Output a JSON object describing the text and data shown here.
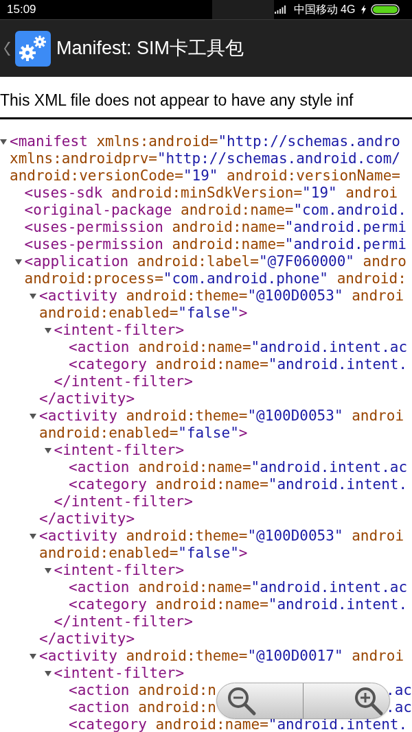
{
  "status_bar": {
    "time": "15:09",
    "carrier": "中国移动 4G"
  },
  "header": {
    "title": "Manifest: SIM卡工具包"
  },
  "notice": "This XML file does not appear to have any style inf",
  "xml": [
    {
      "expanded": true,
      "lines": [
        [
          {
            "kind": "tag",
            "text": "<manifest"
          },
          {
            "kind": "attr",
            "text": " xmlns:android="
          },
          {
            "kind": "val",
            "text": "\"http://schemas.andro"
          }
        ],
        [
          {
            "kind": "attr",
            "text": "xmlns:androidprv="
          },
          {
            "kind": "val",
            "text": "\"http://schemas.android.com/"
          }
        ],
        [
          {
            "kind": "attr",
            "text": "android:versionCode="
          },
          {
            "kind": "val",
            "text": "\"19\""
          },
          {
            "kind": "attr",
            "text": " android:versionName="
          }
        ]
      ],
      "children": [
        {
          "lines": [
            [
              {
                "kind": "tag",
                "text": "<uses-sdk"
              },
              {
                "kind": "attr",
                "text": " android:minSdkVersion="
              },
              {
                "kind": "val",
                "text": "\"19\""
              },
              {
                "kind": "attr",
                "text": " androi"
              }
            ]
          ]
        },
        {
          "lines": [
            [
              {
                "kind": "tag",
                "text": "<original-package"
              },
              {
                "kind": "attr",
                "text": " android:name="
              },
              {
                "kind": "val",
                "text": "\"com.android."
              }
            ]
          ]
        },
        {
          "lines": [
            [
              {
                "kind": "tag",
                "text": "<uses-permission"
              },
              {
                "kind": "attr",
                "text": " android:name="
              },
              {
                "kind": "val",
                "text": "\"android.permi"
              }
            ]
          ]
        },
        {
          "lines": [
            [
              {
                "kind": "tag",
                "text": "<uses-permission"
              },
              {
                "kind": "attr",
                "text": " android:name="
              },
              {
                "kind": "val",
                "text": "\"android.permi"
              }
            ]
          ]
        },
        {
          "expanded": true,
          "lines": [
            [
              {
                "kind": "tag",
                "text": "<application"
              },
              {
                "kind": "attr",
                "text": " android:label="
              },
              {
                "kind": "val",
                "text": "\"@7F060000\""
              },
              {
                "kind": "attr",
                "text": " andro"
              }
            ],
            [
              {
                "kind": "attr",
                "text": "android:process="
              },
              {
                "kind": "val",
                "text": "\"com.android.phone\""
              },
              {
                "kind": "attr",
                "text": " android:"
              }
            ]
          ],
          "children": [
            {
              "expanded": true,
              "lines": [
                [
                  {
                    "kind": "tag",
                    "text": "<activity"
                  },
                  {
                    "kind": "attr",
                    "text": " android:theme="
                  },
                  {
                    "kind": "val",
                    "text": "\"@100D0053\""
                  },
                  {
                    "kind": "attr",
                    "text": " androi"
                  }
                ],
                [
                  {
                    "kind": "attr",
                    "text": "android:enabled="
                  },
                  {
                    "kind": "val",
                    "text": "\"false\""
                  },
                  {
                    "kind": "tag",
                    "text": ">"
                  }
                ]
              ],
              "children": [
                {
                  "expanded": true,
                  "lines": [
                    [
                      {
                        "kind": "tag",
                        "text": "<intent-filter>"
                      }
                    ]
                  ],
                  "children": [
                    {
                      "lines": [
                        [
                          {
                            "kind": "tag",
                            "text": "<action"
                          },
                          {
                            "kind": "attr",
                            "text": " android:name="
                          },
                          {
                            "kind": "val",
                            "text": "\"android.intent.ac"
                          }
                        ]
                      ]
                    },
                    {
                      "lines": [
                        [
                          {
                            "kind": "tag",
                            "text": "<category"
                          },
                          {
                            "kind": "attr",
                            "text": " android:name="
                          },
                          {
                            "kind": "val",
                            "text": "\"android.intent."
                          }
                        ]
                      ]
                    }
                  ],
                  "close": [
                    {
                      "kind": "tag",
                      "text": "</intent-filter>"
                    }
                  ]
                }
              ],
              "close": [
                {
                  "kind": "tag",
                  "text": "</activity>"
                }
              ]
            },
            {
              "expanded": true,
              "lines": [
                [
                  {
                    "kind": "tag",
                    "text": "<activity"
                  },
                  {
                    "kind": "attr",
                    "text": " android:theme="
                  },
                  {
                    "kind": "val",
                    "text": "\"@100D0053\""
                  },
                  {
                    "kind": "attr",
                    "text": " androi"
                  }
                ],
                [
                  {
                    "kind": "attr",
                    "text": "android:enabled="
                  },
                  {
                    "kind": "val",
                    "text": "\"false\""
                  },
                  {
                    "kind": "tag",
                    "text": ">"
                  }
                ]
              ],
              "children": [
                {
                  "expanded": true,
                  "lines": [
                    [
                      {
                        "kind": "tag",
                        "text": "<intent-filter>"
                      }
                    ]
                  ],
                  "children": [
                    {
                      "lines": [
                        [
                          {
                            "kind": "tag",
                            "text": "<action"
                          },
                          {
                            "kind": "attr",
                            "text": " android:name="
                          },
                          {
                            "kind": "val",
                            "text": "\"android.intent.ac"
                          }
                        ]
                      ]
                    },
                    {
                      "lines": [
                        [
                          {
                            "kind": "tag",
                            "text": "<category"
                          },
                          {
                            "kind": "attr",
                            "text": " android:name="
                          },
                          {
                            "kind": "val",
                            "text": "\"android.intent."
                          }
                        ]
                      ]
                    }
                  ],
                  "close": [
                    {
                      "kind": "tag",
                      "text": "</intent-filter>"
                    }
                  ]
                }
              ],
              "close": [
                {
                  "kind": "tag",
                  "text": "</activity>"
                }
              ]
            },
            {
              "expanded": true,
              "lines": [
                [
                  {
                    "kind": "tag",
                    "text": "<activity"
                  },
                  {
                    "kind": "attr",
                    "text": " android:theme="
                  },
                  {
                    "kind": "val",
                    "text": "\"@100D0053\""
                  },
                  {
                    "kind": "attr",
                    "text": " androi"
                  }
                ],
                [
                  {
                    "kind": "attr",
                    "text": "android:enabled="
                  },
                  {
                    "kind": "val",
                    "text": "\"false\""
                  },
                  {
                    "kind": "tag",
                    "text": ">"
                  }
                ]
              ],
              "children": [
                {
                  "expanded": true,
                  "lines": [
                    [
                      {
                        "kind": "tag",
                        "text": "<intent-filter>"
                      }
                    ]
                  ],
                  "children": [
                    {
                      "lines": [
                        [
                          {
                            "kind": "tag",
                            "text": "<action"
                          },
                          {
                            "kind": "attr",
                            "text": " android:name="
                          },
                          {
                            "kind": "val",
                            "text": "\"android.intent.ac"
                          }
                        ]
                      ]
                    },
                    {
                      "lines": [
                        [
                          {
                            "kind": "tag",
                            "text": "<category"
                          },
                          {
                            "kind": "attr",
                            "text": " android:name="
                          },
                          {
                            "kind": "val",
                            "text": "\"android.intent."
                          }
                        ]
                      ]
                    }
                  ],
                  "close": [
                    {
                      "kind": "tag",
                      "text": "</intent-filter>"
                    }
                  ]
                }
              ],
              "close": [
                {
                  "kind": "tag",
                  "text": "</activity>"
                }
              ]
            },
            {
              "expanded": true,
              "lines": [
                [
                  {
                    "kind": "tag",
                    "text": "<activity"
                  },
                  {
                    "kind": "attr",
                    "text": " android:theme="
                  },
                  {
                    "kind": "val",
                    "text": "\"@100D0017\""
                  },
                  {
                    "kind": "attr",
                    "text": " androi"
                  }
                ]
              ],
              "children": [
                {
                  "expanded": true,
                  "lines": [
                    [
                      {
                        "kind": "tag",
                        "text": "<intent-filter>"
                      }
                    ]
                  ],
                  "children": [
                    {
                      "lines": [
                        [
                          {
                            "kind": "tag",
                            "text": "<action"
                          },
                          {
                            "kind": "attr",
                            "text": " android:n"
                          },
                          {
                            "kind": "tail",
                            "text": ".ac"
                          }
                        ]
                      ]
                    },
                    {
                      "lines": [
                        [
                          {
                            "kind": "tag",
                            "text": "<action"
                          },
                          {
                            "kind": "attr",
                            "text": " android:n"
                          },
                          {
                            "kind": "tail",
                            "text": ".ac"
                          }
                        ]
                      ]
                    },
                    {
                      "lines": [
                        [
                          {
                            "kind": "tag",
                            "text": "<category"
                          },
                          {
                            "kind": "attr",
                            "text": " android:name="
                          },
                          {
                            "kind": "val",
                            "text": "\"android.intent."
                          }
                        ]
                      ]
                    }
                  ]
                }
              ]
            }
          ]
        }
      ]
    }
  ]
}
